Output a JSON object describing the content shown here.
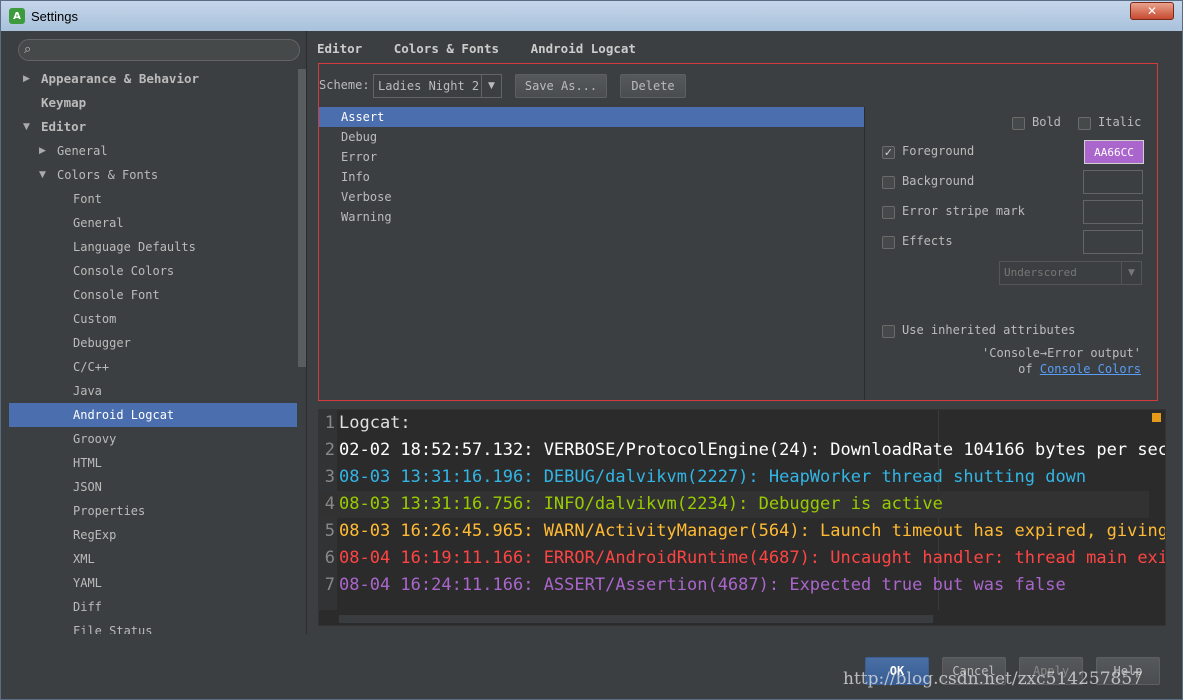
{
  "window": {
    "title": "Settings",
    "close_icon": "✕"
  },
  "search": {
    "placeholder": ""
  },
  "tree": [
    {
      "label": "Appearance & Behavior",
      "level": 0,
      "arrow": "right",
      "bold": true
    },
    {
      "label": "Keymap",
      "level": 0,
      "arrow": "",
      "bold": true
    },
    {
      "label": "Editor",
      "level": 0,
      "arrow": "down",
      "bold": true
    },
    {
      "label": "General",
      "level": 1,
      "arrow": "right",
      "bold": false
    },
    {
      "label": "Colors & Fonts",
      "level": 1,
      "arrow": "down",
      "bold": false
    },
    {
      "label": "Font",
      "level": 2,
      "arrow": "",
      "bold": false
    },
    {
      "label": "General",
      "level": 2,
      "arrow": "",
      "bold": false
    },
    {
      "label": "Language Defaults",
      "level": 2,
      "arrow": "",
      "bold": false
    },
    {
      "label": "Console Colors",
      "level": 2,
      "arrow": "",
      "bold": false
    },
    {
      "label": "Console Font",
      "level": 2,
      "arrow": "",
      "bold": false
    },
    {
      "label": "Custom",
      "level": 2,
      "arrow": "",
      "bold": false
    },
    {
      "label": "Debugger",
      "level": 2,
      "arrow": "",
      "bold": false
    },
    {
      "label": "C/C++",
      "level": 2,
      "arrow": "",
      "bold": false
    },
    {
      "label": "Java",
      "level": 2,
      "arrow": "",
      "bold": false
    },
    {
      "label": "Android Logcat",
      "level": 2,
      "arrow": "",
      "bold": false,
      "selected": true
    },
    {
      "label": "Groovy",
      "level": 2,
      "arrow": "",
      "bold": false
    },
    {
      "label": "HTML",
      "level": 2,
      "arrow": "",
      "bold": false
    },
    {
      "label": "JSON",
      "level": 2,
      "arrow": "",
      "bold": false
    },
    {
      "label": "Properties",
      "level": 2,
      "arrow": "",
      "bold": false
    },
    {
      "label": "RegExp",
      "level": 2,
      "arrow": "",
      "bold": false
    },
    {
      "label": "XML",
      "level": 2,
      "arrow": "",
      "bold": false
    },
    {
      "label": "YAML",
      "level": 2,
      "arrow": "",
      "bold": false
    },
    {
      "label": "Diff",
      "level": 2,
      "arrow": "",
      "bold": false
    },
    {
      "label": "File Status",
      "level": 2,
      "arrow": "",
      "bold": false
    }
  ],
  "breadcrumb": [
    "Editor",
    "Colors & Fonts",
    "Android Logcat"
  ],
  "scheme": {
    "label": "Scheme:",
    "selected": "Ladies Night 2",
    "save_as": "Save As...",
    "delete": "Delete"
  },
  "levels": [
    {
      "label": "Assert",
      "selected": true
    },
    {
      "label": "Debug"
    },
    {
      "label": "Error"
    },
    {
      "label": "Info"
    },
    {
      "label": "Verbose"
    },
    {
      "label": "Warning"
    }
  ],
  "attributes": {
    "bold": "Bold",
    "italic": "Italic",
    "foreground": "Foreground",
    "foreground_checked": true,
    "foreground_color": "AA66CC",
    "foreground_hex": "#aa66cc",
    "background": "Background",
    "error_stripe": "Error stripe mark",
    "effects": "Effects",
    "effect_type": "Underscored",
    "use_inherited": "Use inherited attributes",
    "inherit_source": "'Console→Error output'",
    "inherit_of": "of",
    "inherit_link": "Console Colors"
  },
  "preview": {
    "lines": [
      {
        "n": "1",
        "text": "Logcat:",
        "color": "#e0e0e0"
      },
      {
        "n": "2",
        "text": "02-02 18:52:57.132: VERBOSE/ProtocolEngine(24): DownloadRate 104166 bytes per sec",
        "color": "#ffffff"
      },
      {
        "n": "3",
        "text": "08-03 13:31:16.196: DEBUG/dalvikvm(2227): HeapWorker thread shutting down",
        "color": "#33b5e5"
      },
      {
        "n": "4",
        "text": "08-03 13:31:16.756: INFO/dalvikvm(2234): Debugger is active",
        "color": "#99cc00",
        "current": true
      },
      {
        "n": "5",
        "text": "08-03 16:26:45.965: WARN/ActivityManager(564): Launch timeout has expired, giving",
        "color": "#ffbb33"
      },
      {
        "n": "6",
        "text": "08-04 16:19:11.166: ERROR/AndroidRuntime(4687): Uncaught handler: thread main exi",
        "color": "#ff4444"
      },
      {
        "n": "7",
        "text": "08-04 16:24:11.166: ASSERT/Assertion(4687): Expected true but was false",
        "color": "#aa66cc"
      }
    ]
  },
  "footer": {
    "ok": "OK",
    "cancel": "Cancel",
    "apply": "Apply",
    "help": "Help"
  },
  "watermark": "http://blog.csdn.net/zxc514257857"
}
